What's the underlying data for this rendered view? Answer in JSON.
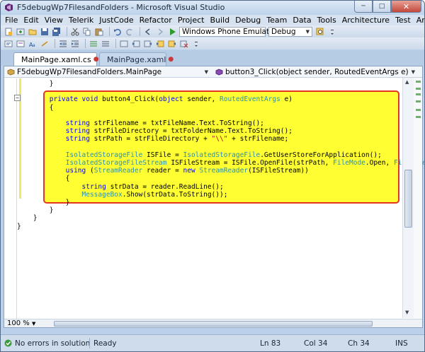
{
  "window": {
    "title": "F5debugWp7FilesandFolders - Microsoft Visual Studio"
  },
  "menu": [
    "File",
    "Edit",
    "View",
    "Telerik",
    "JustCode",
    "Refactor",
    "Project",
    "Build",
    "Debug",
    "Team",
    "Data",
    "Tools",
    "Architecture",
    "Test",
    "Analyze",
    "Window",
    "Help"
  ],
  "toolbar": {
    "target_device": "Windows Phone Emulator",
    "configuration": "Debug"
  },
  "tabs": [
    {
      "label": "MainPage.xaml.cs",
      "dirty_mark": "●",
      "close": "×"
    },
    {
      "label": "MainPage.xaml",
      "dirty_mark": "●"
    }
  ],
  "navbar": {
    "class_selector": "F5debugWp7FilesandFolders.MainPage",
    "member_selector": "button3_Click(object sender, RoutedEventArgs e)"
  },
  "code_lines": [
    [
      [
        "tx",
        "        }"
      ]
    ],
    [
      [
        "tx",
        ""
      ]
    ],
    [
      [
        "kw",
        "        private void "
      ],
      [
        "tx",
        "button4_Click("
      ],
      [
        "kw",
        "object"
      ],
      [
        "tx",
        " sender, "
      ],
      [
        "ty",
        "RoutedEventArgs"
      ],
      [
        "tx",
        " e)"
      ]
    ],
    [
      [
        "tx",
        "        {"
      ]
    ],
    [
      [
        "tx",
        ""
      ]
    ],
    [
      [
        "kw",
        "            string"
      ],
      [
        "tx",
        " strFilename = txtFileName.Text.ToString();"
      ]
    ],
    [
      [
        "kw",
        "            string"
      ],
      [
        "tx",
        " strFileDirectory = txtFolderName.Text.ToString();"
      ]
    ],
    [
      [
        "kw",
        "            string"
      ],
      [
        "tx",
        " strPath = strFileDirectory + "
      ],
      [
        "st",
        "\"\\\\\""
      ],
      [
        "tx",
        " + strFilename;"
      ]
    ],
    [
      [
        "tx",
        ""
      ]
    ],
    [
      [
        "ty",
        "            IsolatedStorageFile"
      ],
      [
        "tx",
        " ISFile = "
      ],
      [
        "ty",
        "IsolatedStorageFile"
      ],
      [
        "tx",
        ".GetUserStoreForApplication();"
      ]
    ],
    [
      [
        "ty",
        "            IsolatedStorageFileStream"
      ],
      [
        "tx",
        " ISFileStream = ISFile.OpenFile(strPath, "
      ],
      [
        "ty",
        "FileMode"
      ],
      [
        "tx",
        ".Open, "
      ],
      [
        "ty",
        "FileAccess"
      ],
      [
        "tx",
        ".Read);"
      ]
    ],
    [
      [
        "kw",
        "            using"
      ],
      [
        "tx",
        " ("
      ],
      [
        "ty",
        "StreamReader"
      ],
      [
        "tx",
        " reader = "
      ],
      [
        "kw",
        "new"
      ],
      [
        "tx",
        " "
      ],
      [
        "ty",
        "StreamReader"
      ],
      [
        "tx",
        "(ISFileStream))"
      ]
    ],
    [
      [
        "tx",
        "            {"
      ]
    ],
    [
      [
        "kw",
        "                string"
      ],
      [
        "tx",
        " strData = reader.ReadLine();"
      ]
    ],
    [
      [
        "ty",
        "                MessageBox"
      ],
      [
        "tx",
        ".Show(strData.ToString());"
      ]
    ],
    [
      [
        "tx",
        "            }"
      ]
    ],
    [
      [
        "tx",
        "        }"
      ]
    ],
    [
      [
        "tx",
        "    }"
      ]
    ],
    [
      [
        "tx",
        "}"
      ]
    ]
  ],
  "zoom": "100 %",
  "status": {
    "errors": "No errors in solution",
    "state": "Ready",
    "line": "Ln 83",
    "col": "Col 34",
    "ch": "Ch 34",
    "mode": "INS"
  }
}
